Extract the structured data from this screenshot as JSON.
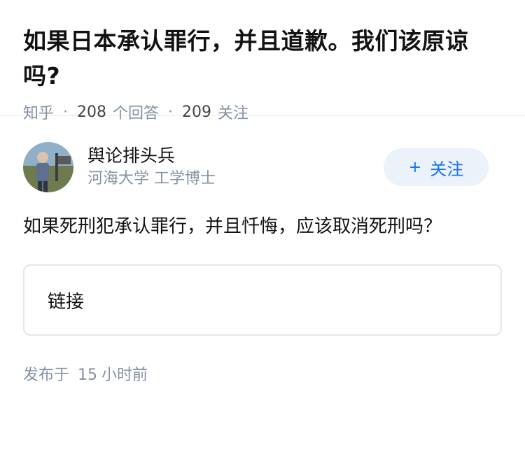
{
  "question": {
    "title": "如果日本承认罪行，并且道歉。我们该原谅吗?",
    "source": "知乎",
    "answer_count": "208",
    "answer_label": "个回答",
    "follower_count": "209",
    "follower_label": "关注"
  },
  "answer": {
    "author_name": "舆论排头兵",
    "author_desc": "河海大学 工学博士",
    "follow_label": "关注",
    "content": "如果死刑犯承认罪行，并且忏悔，应该取消死刑吗？",
    "link_label": "链接",
    "published_prefix": "发布于",
    "published_num": "15",
    "published_unit": "小时前"
  },
  "colors": {
    "accent": "#1772f6",
    "meta": "#8590a6",
    "button_bg": "#ebf2fa"
  },
  "icons": {
    "avatar": "avatar-photo",
    "follow": "plus-icon"
  }
}
